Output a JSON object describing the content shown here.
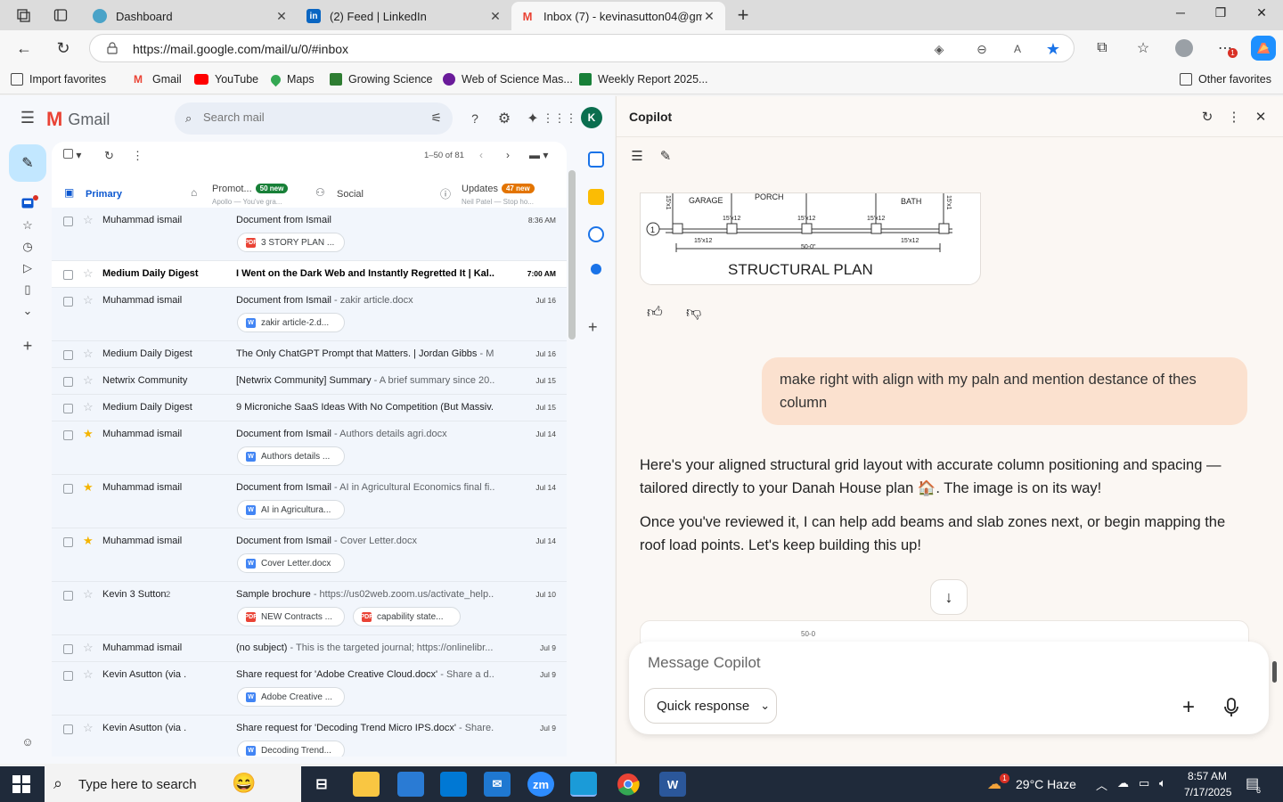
{
  "browser": {
    "tabs": [
      {
        "title": "Dashboard",
        "active": false
      },
      {
        "title": "(2) Feed | LinkedIn",
        "active": false
      },
      {
        "title": "Inbox (7) - kevinasutton04@gma",
        "active": true
      }
    ],
    "url": "https://mail.google.com/mail/u/0/#inbox",
    "favorites": [
      "Import favorites",
      "Gmail",
      "YouTube",
      "Maps",
      "Growing Science",
      "Web of Science Mas...",
      "Weekly Report 2025..."
    ],
    "other_favorites": "Other favorites",
    "extension_badge": "1"
  },
  "gmail": {
    "brand": "Gmail",
    "search_placeholder": "Search mail",
    "avatar_letter": "K",
    "page_count": "1–50 of 81",
    "tabs": [
      {
        "label": "Primary",
        "selected": true
      },
      {
        "label": "Promot...",
        "badge": "50 new",
        "badge_color": "#188038",
        "sub": "Apollo — You've gra..."
      },
      {
        "label": "Social"
      },
      {
        "label": "Updates",
        "badge": "47 new",
        "badge_color": "#e37400",
        "sub": "Neil Patel — Stop ho..."
      }
    ],
    "emails": [
      {
        "sender": "Muhammad ismail",
        "subject": "Document from Ismail",
        "snippet": "",
        "date": "8:36 AM",
        "starred": false,
        "unread": false,
        "attachments": [
          {
            "type": "pdf",
            "name": "3 STORY PLAN ..."
          }
        ]
      },
      {
        "sender": "Medium Daily Digest",
        "subject": "I Went on the Dark Web and Instantly Regretted It | Kal...",
        "snippet": "",
        "date": "7:00 AM",
        "starred": false,
        "unread": true,
        "attachments": []
      },
      {
        "sender": "Muhammad ismail",
        "subject": "Document from Ismail",
        "snippet": " - zakir article.docx",
        "date": "Jul 16",
        "starred": false,
        "unread": false,
        "attachments": [
          {
            "type": "doc",
            "name": "zakir article-2.d..."
          }
        ]
      },
      {
        "sender": "Medium Daily Digest",
        "subject": "The Only ChatGPT Prompt that Matters. | Jordan Gibbs",
        "snippet": " - M...",
        "date": "Jul 16",
        "starred": false,
        "unread": false,
        "attachments": []
      },
      {
        "sender": "Netwrix Community",
        "subject": "[Netwrix Community] Summary",
        "snippet": " - A brief summary since 20...",
        "date": "Jul 15",
        "starred": false,
        "unread": false,
        "attachments": []
      },
      {
        "sender": "Medium Daily Digest",
        "subject": "9 Microniche SaaS Ideas With No Competition (But Massiv...",
        "snippet": "",
        "date": "Jul 15",
        "starred": false,
        "unread": false,
        "attachments": []
      },
      {
        "sender": "Muhammad ismail",
        "subject": "Document from Ismail",
        "snippet": " - Authors details agri.docx",
        "date": "Jul 14",
        "starred": true,
        "unread": false,
        "attachments": [
          {
            "type": "doc",
            "name": "Authors details ..."
          }
        ]
      },
      {
        "sender": "Muhammad ismail",
        "subject": "Document from Ismail",
        "snippet": " - AI in Agricultural Economics final fi...",
        "date": "Jul 14",
        "starred": true,
        "unread": false,
        "attachments": [
          {
            "type": "doc",
            "name": "AI in Agricultura..."
          }
        ]
      },
      {
        "sender": "Muhammad ismail",
        "subject": "Document from Ismail",
        "snippet": " - Cover Letter.docx",
        "date": "Jul 14",
        "starred": true,
        "unread": false,
        "attachments": [
          {
            "type": "doc",
            "name": "Cover Letter.docx"
          }
        ]
      },
      {
        "sender": "Kevin 3 Sutton",
        "sender_count": "2",
        "subject": "Sample brochure",
        "snippet": " - https://us02web.zoom.us/activate_help...",
        "date": "Jul 10",
        "starred": false,
        "unread": false,
        "attachments": [
          {
            "type": "pdf",
            "name": "NEW Contracts ..."
          },
          {
            "type": "pdf",
            "name": "capability state..."
          }
        ]
      },
      {
        "sender": "Muhammad ismail",
        "subject": "(no subject)",
        "snippet": " - This is the targeted journal; https://onlinelibr...",
        "date": "Jul 9",
        "starred": false,
        "unread": false,
        "attachments": []
      },
      {
        "sender": "Kevin Asutton (via .",
        "subject": "Share request for 'Adobe Creative Cloud.docx'",
        "snippet": " - Share a d...",
        "date": "Jul 9",
        "starred": false,
        "unread": false,
        "attachments": [
          {
            "type": "doc",
            "name": "Adobe Creative ..."
          }
        ]
      },
      {
        "sender": "Kevin Asutton (via .",
        "subject": "Share request for 'Decoding Trend Micro IPS.docx'",
        "snippet": " - Share...",
        "date": "Jul 9",
        "starred": false,
        "unread": false,
        "attachments": [
          {
            "type": "doc",
            "name": "Decoding Trend..."
          }
        ]
      }
    ]
  },
  "copilot": {
    "title": "Copilot",
    "plan_image": {
      "labels": [
        "GARAGE",
        "PORCH",
        "BATH"
      ],
      "dims": [
        "15'x12",
        "15'x12",
        "15'x12",
        "15'x12",
        "15'x12"
      ],
      "side_dims": [
        "15'x1",
        "15'x1"
      ],
      "span": "50-0\"",
      "axis": "1",
      "caption": "STRUCTURAL PLAN"
    },
    "user_message": "make right with align with my paln and mention destance of thes column",
    "assistant_paragraphs": [
      "Here's your aligned structural grid layout with accurate column positioning and spacing — tailored directly to your Danah House plan 🏠. The image is on its way!",
      "Once you've reviewed it, I can help add beams and slab zones next, or begin mapping the roof load points. Let's keep building this up!"
    ],
    "peek_label": "50-0",
    "composer_placeholder": "Message Copilot",
    "mode_label": "Quick response"
  },
  "taskbar": {
    "search_text": "Type here to search",
    "weather": "29°C  Haze",
    "weather_badge": "1",
    "time": "8:57 AM",
    "date": "7/17/2025",
    "notif_count": "6",
    "app_labels": {
      "zoom": "zm",
      "word": "W"
    }
  }
}
